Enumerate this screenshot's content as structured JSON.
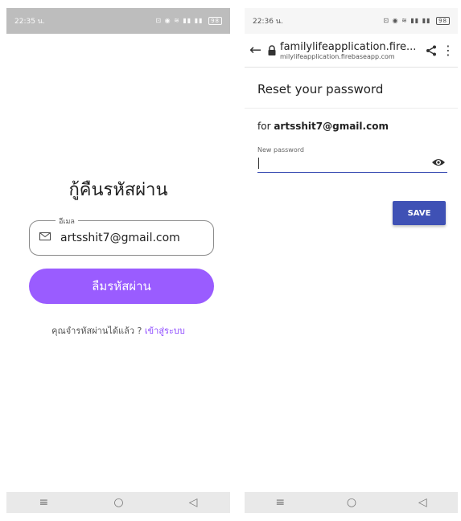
{
  "left_screen": {
    "status": {
      "time": "22:35 น.",
      "icons": "⊡ ◉ ≋ ▮▮ ▮▮",
      "battery": "98"
    },
    "title": "กู้คืนรหัสผ่าน",
    "email_field": {
      "legend": "อีเมล",
      "icon": "mail-icon",
      "value": "artsshit7@gmail.com"
    },
    "forgot_button": "ลืมรหัสผ่าน",
    "remember_text": "คุณจำรหัสผ่านได้แล้ว ?",
    "login_link": "เข้าสู่ระบบ",
    "nav": {
      "menu": "≡",
      "home": "○",
      "back": "◁"
    }
  },
  "right_screen": {
    "status": {
      "time": "22:36 น.",
      "icons": "⊡ ◉ ≋ ▮▮ ▮▮",
      "battery": "98"
    },
    "browser": {
      "url_main": "familylifeapplication.fire...",
      "url_sub": "milylifeapplication.firebaseapp.com"
    },
    "page_title": "Reset your password",
    "for_prefix": "for",
    "for_email": "artsshit7@gmail.com",
    "new_password_label": "New password",
    "new_password_value": "",
    "save_button": "SAVE",
    "nav": {
      "menu": "≡",
      "home": "○",
      "back": "◁"
    }
  },
  "colors": {
    "purple_accent": "#9a5cff",
    "link_purple": "#8e4bff",
    "firebase_blue": "#3f51b5"
  }
}
